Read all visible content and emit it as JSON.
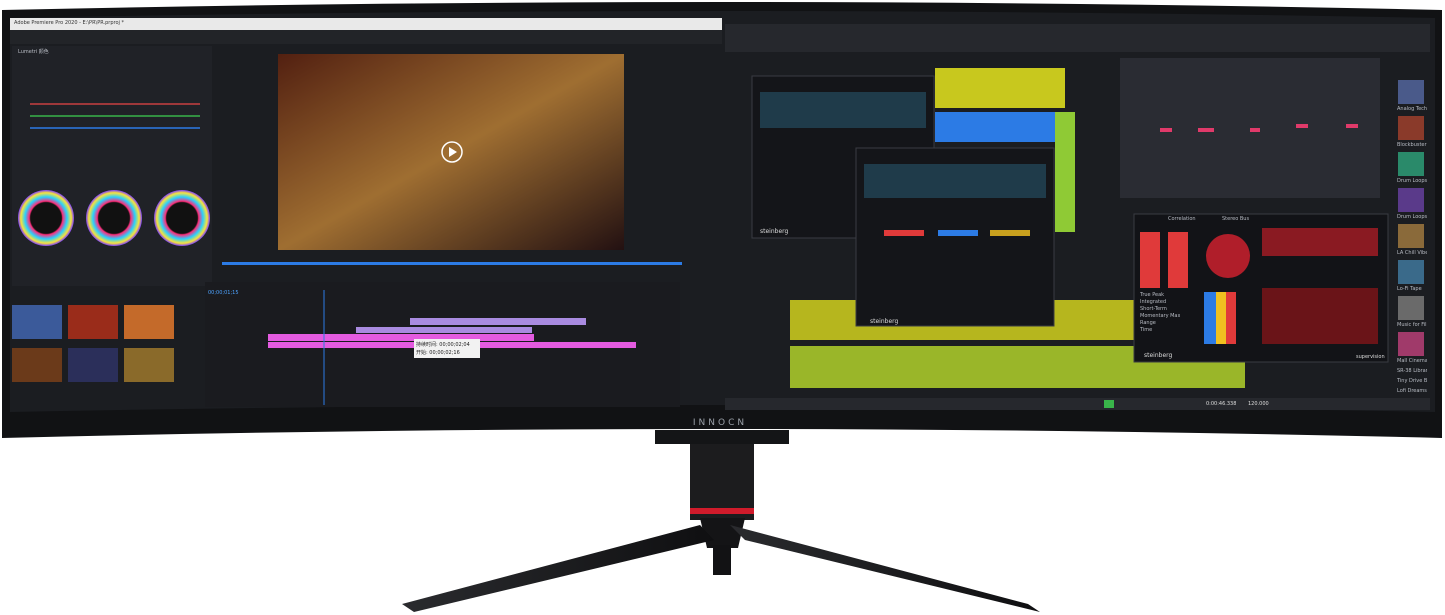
{
  "brand_logo_text": "INNOCN",
  "left_app": {
    "title": "Adobe Premiere Pro 2020 - E:\\PR\\PR.prproj *",
    "panel": "Lumetri 颜色",
    "timecode": "00;00;01;15",
    "clip_tooltip": {
      "line1": "持续时间: 00;00;02;04",
      "line2": "开始: 00;00;02;16"
    }
  },
  "right_app": {
    "brand": "steinberg",
    "plugin_names": [
      "supervision",
      "Correlation",
      "Stereo Bus"
    ],
    "transport_time": "0:00:46.338",
    "tempo": "120.000",
    "meter_labels": [
      "True Peak",
      "Integrated",
      "Short-Term",
      "Momentary Max",
      "Range",
      "Time"
    ],
    "sidebar": [
      "Analog Techno",
      "Blockbuster",
      "Drum Loops",
      "Drum Loops",
      "LA Chill Vibes",
      "Lo-Fi Tape",
      "Music for Film",
      "Mall Cinema",
      "SR-38 Library",
      "Tiny Drive Beats",
      "Lofi Dreams"
    ]
  },
  "colors": {
    "bezel": "#111214",
    "screen_dark": "#1b1d21",
    "accent_blue": "#2c7be5",
    "clip_purple": "#a98be0",
    "clip_magenta": "#e45be0",
    "waveform_yellow": "#c8c81e",
    "waveform_green": "#8fca35",
    "meter_red": "#e03a3a",
    "stand": "#1c1c1e",
    "stand_ring": "#d01b2b"
  }
}
